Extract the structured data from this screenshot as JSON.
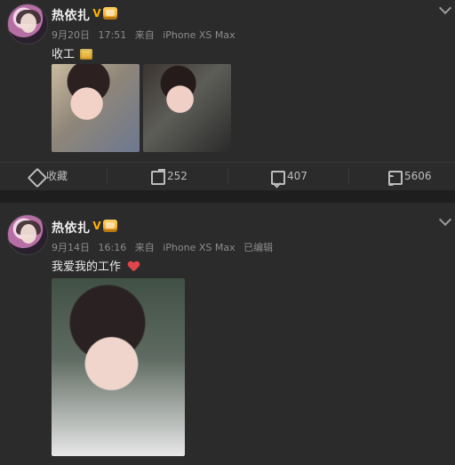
{
  "posts": [
    {
      "user": {
        "name": "热依扎",
        "verified_badge": "V"
      },
      "meta": {
        "date": "9月20日",
        "time": "17:51",
        "source_prefix": "来自",
        "device": "iPhone XS Max"
      },
      "text": {
        "content": "收工"
      },
      "toolbar": {
        "favorite_label": "收藏",
        "share_count": "252",
        "comment_count": "407",
        "like_count": "5606"
      }
    },
    {
      "user": {
        "name": "热依扎",
        "verified_badge": "V"
      },
      "meta": {
        "date": "9月14日",
        "time": "16:16",
        "source_prefix": "来自",
        "device": "iPhone XS Max",
        "edited": "已编辑"
      },
      "text": {
        "content": "我爱我的工作"
      }
    }
  ],
  "colors": {
    "bg": "#1e1e1e",
    "card": "#2b2b2b",
    "muted": "#8c8c8c",
    "accent_heart": "#e0454d",
    "badge_gold": "#ffb300"
  }
}
